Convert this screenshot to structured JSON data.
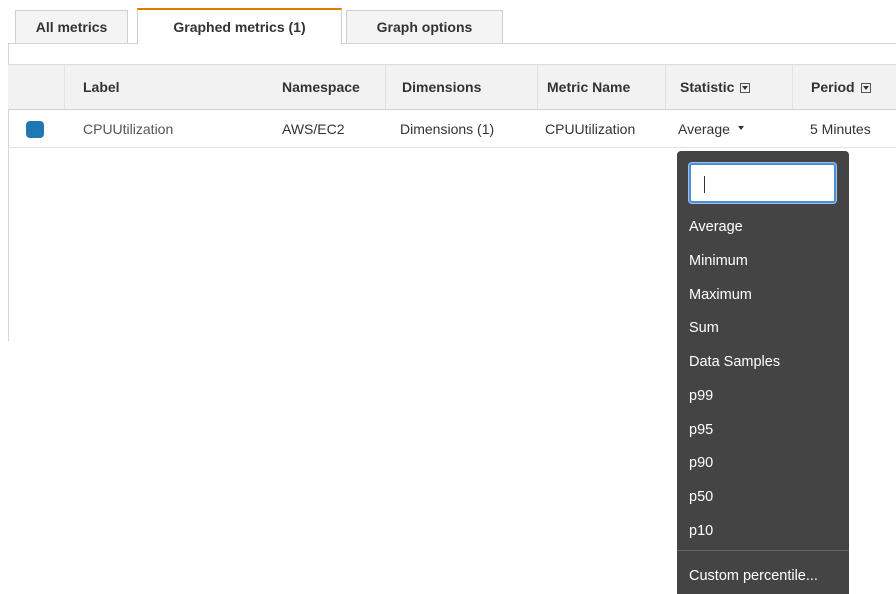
{
  "tabs": [
    {
      "label": "All metrics"
    },
    {
      "label": "Graphed metrics (1)"
    },
    {
      "label": "Graph options"
    }
  ],
  "table": {
    "headers": {
      "label": "Label",
      "namespace": "Namespace",
      "dimensions": "Dimensions",
      "metric_name": "Metric Name",
      "statistic": "Statistic",
      "period": "Period"
    },
    "rows": [
      {
        "color": "#1f77b4",
        "label": "CPUUtilization",
        "namespace": "AWS/EC2",
        "dimensions": "Dimensions (1)",
        "metric_name": "CPUUtilization",
        "statistic": "Average",
        "period": "5 Minutes"
      }
    ]
  },
  "statistic_dropdown": {
    "search_value": "",
    "options": [
      "Average",
      "Minimum",
      "Maximum",
      "Sum",
      "Data Samples",
      "p99",
      "p95",
      "p90",
      "p50",
      "p10"
    ],
    "footer_option": "Custom percentile..."
  }
}
